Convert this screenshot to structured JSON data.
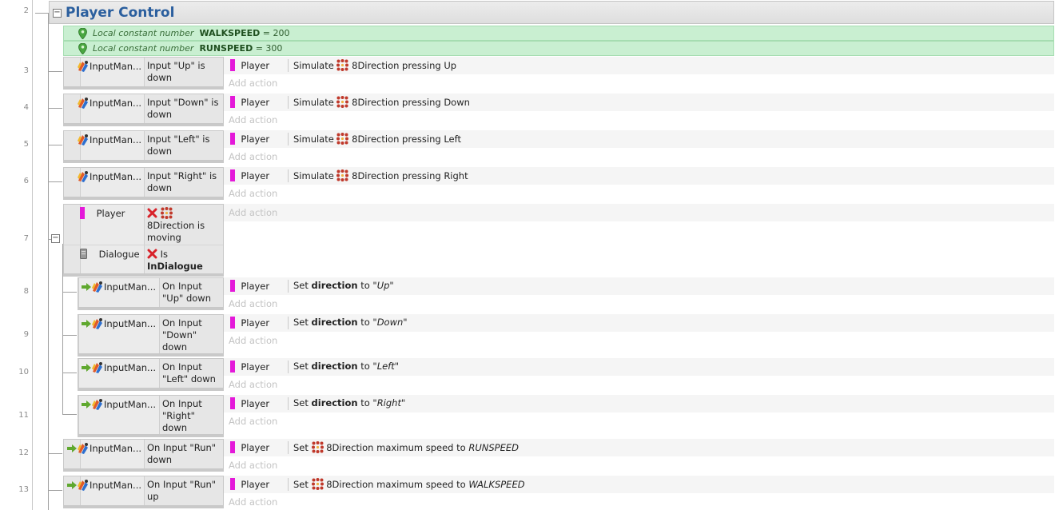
{
  "group": {
    "title": "Player Control"
  },
  "line_numbers": [
    "2",
    "3",
    "4",
    "5",
    "6",
    "7",
    "8",
    "9",
    "10",
    "11",
    "12",
    "13"
  ],
  "constants": [
    {
      "kind": "Local constant number",
      "name": "WALKSPEED",
      "value": "= 200"
    },
    {
      "kind": "Local constant number",
      "name": "RUNSPEED",
      "value": "= 300"
    }
  ],
  "add_action_label": "Add action",
  "events": [
    {
      "cond_obj": "InputMan...",
      "cond": "Input \"Up\" is down",
      "act_obj": "Player",
      "act_prefix": "Simulate",
      "act_suffix": "8Direction pressing Up"
    },
    {
      "cond_obj": "InputMan...",
      "cond": "Input \"Down\" is down",
      "act_obj": "Player",
      "act_prefix": "Simulate",
      "act_suffix": "8Direction pressing Down"
    },
    {
      "cond_obj": "InputMan...",
      "cond": "Input \"Left\" is down",
      "act_obj": "Player",
      "act_prefix": "Simulate",
      "act_suffix": "8Direction pressing Left"
    },
    {
      "cond_obj": "InputMan...",
      "cond": "Input \"Right\" is down",
      "act_obj": "Player",
      "act_prefix": "Simulate",
      "act_suffix": "8Direction pressing Right"
    }
  ],
  "parent_event": {
    "cond1_obj": "Player",
    "cond1_text": "8Direction is moving",
    "cond2_obj": "Dialogue",
    "cond2_pre": "Is",
    "cond2_bold": "InDialogue"
  },
  "sub_events": [
    {
      "cond_obj": "InputMan...",
      "cond": "On Input \"Up\" down",
      "act_obj": "Player",
      "act_set": "Set",
      "act_prop": "direction",
      "act_to": "to",
      "act_val": "\"Up\""
    },
    {
      "cond_obj": "InputMan...",
      "cond": "On Input \"Down\" down",
      "act_obj": "Player",
      "act_set": "Set",
      "act_prop": "direction",
      "act_to": "to",
      "act_val": "\"Down\""
    },
    {
      "cond_obj": "InputMan...",
      "cond": "On Input \"Left\" down",
      "act_obj": "Player",
      "act_set": "Set",
      "act_prop": "direction",
      "act_to": "to",
      "act_val": "\"Left\""
    },
    {
      "cond_obj": "InputMan...",
      "cond": "On Input \"Right\" down",
      "act_obj": "Player",
      "act_set": "Set",
      "act_prop": "direction",
      "act_to": "to",
      "act_val": "\"Right\""
    }
  ],
  "speed_events": [
    {
      "cond_obj": "InputMan...",
      "cond": "On Input \"Run\" down",
      "act_obj": "Player",
      "act_set": "Set",
      "act_mid": "8Direction maximum speed to",
      "act_val": "RUNSPEED"
    },
    {
      "cond_obj": "InputMan...",
      "cond": "On Input \"Run\" up",
      "act_obj": "Player",
      "act_set": "Set",
      "act_mid": "8Direction maximum speed to",
      "act_val": "WALKSPEED"
    }
  ],
  "colors": {
    "player_color": "#e419d9",
    "group_title": "#2b5f9e",
    "constant_bg": "#c9efd1"
  },
  "icons": [
    "collapse-icon",
    "pin-icon",
    "input-manager-icon",
    "8direction-icon",
    "trigger-arrow-icon",
    "invert-x-icon",
    "dialogue-icon"
  ]
}
